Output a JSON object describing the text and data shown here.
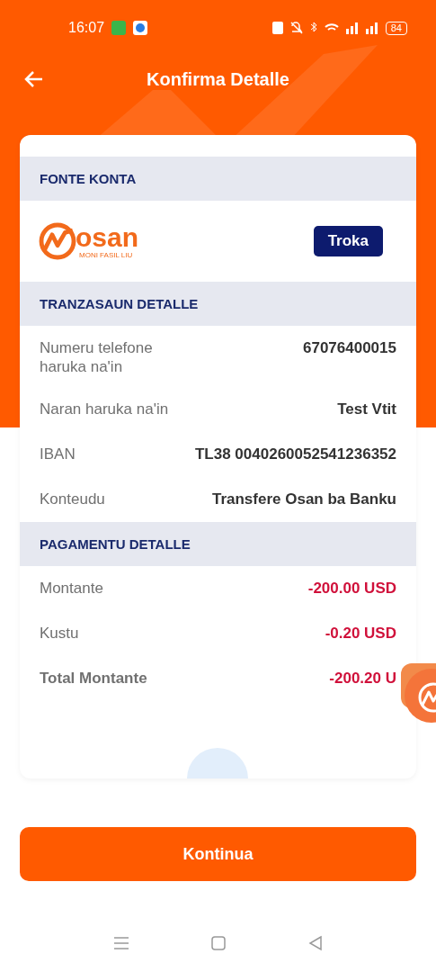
{
  "status_bar": {
    "time": "16:07",
    "battery": "84"
  },
  "header": {
    "title": "Konfirma Detalle"
  },
  "source": {
    "heading": "FONTE KONTA",
    "logo_name": "osan",
    "logo_tagline": "MONI FASIL LIU",
    "change_button": "Troka"
  },
  "transaction": {
    "heading": "TRANZASAUN DETALLE",
    "rows": [
      {
        "label": "Numeru telefone haruka na'in",
        "value": "67076400015"
      },
      {
        "label": "Naran haruka na'in",
        "value": "Test Vtit"
      },
      {
        "label": "IBAN",
        "value": "TL38 0040260052541236352"
      },
      {
        "label": "Konteudu",
        "value": "Transfere Osan ba Banku"
      }
    ]
  },
  "payment": {
    "heading": "PAGAMENTU DETALLE",
    "rows": [
      {
        "label": "Montante",
        "value": "-200.00 USD",
        "total": false
      },
      {
        "label": "Kustu",
        "value": "-0.20 USD",
        "total": false
      },
      {
        "label": "Total Montante",
        "value": "-200.20 U",
        "total": true
      }
    ]
  },
  "continue_button": "Kontinua"
}
